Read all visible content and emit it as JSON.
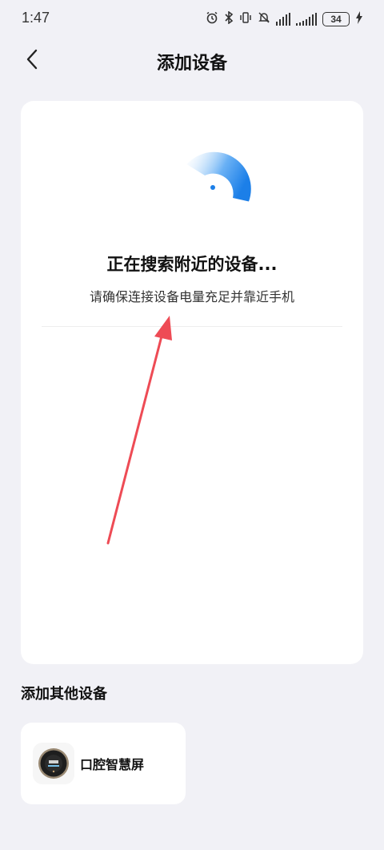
{
  "status_bar": {
    "time": "1:47",
    "battery": "34"
  },
  "header": {
    "title": "添加设备"
  },
  "search": {
    "title": "正在搜索附近的设备...",
    "hint": "请确保连接设备电量充足并靠近手机"
  },
  "other_devices": {
    "section_title": "添加其他设备",
    "items": [
      {
        "name": "口腔智慧屏",
        "icon": "smart-display-icon"
      }
    ]
  },
  "colors": {
    "accent": "#2a8cf0",
    "background": "#f1f1f6",
    "annotation_arrow": "#ee4b55"
  }
}
